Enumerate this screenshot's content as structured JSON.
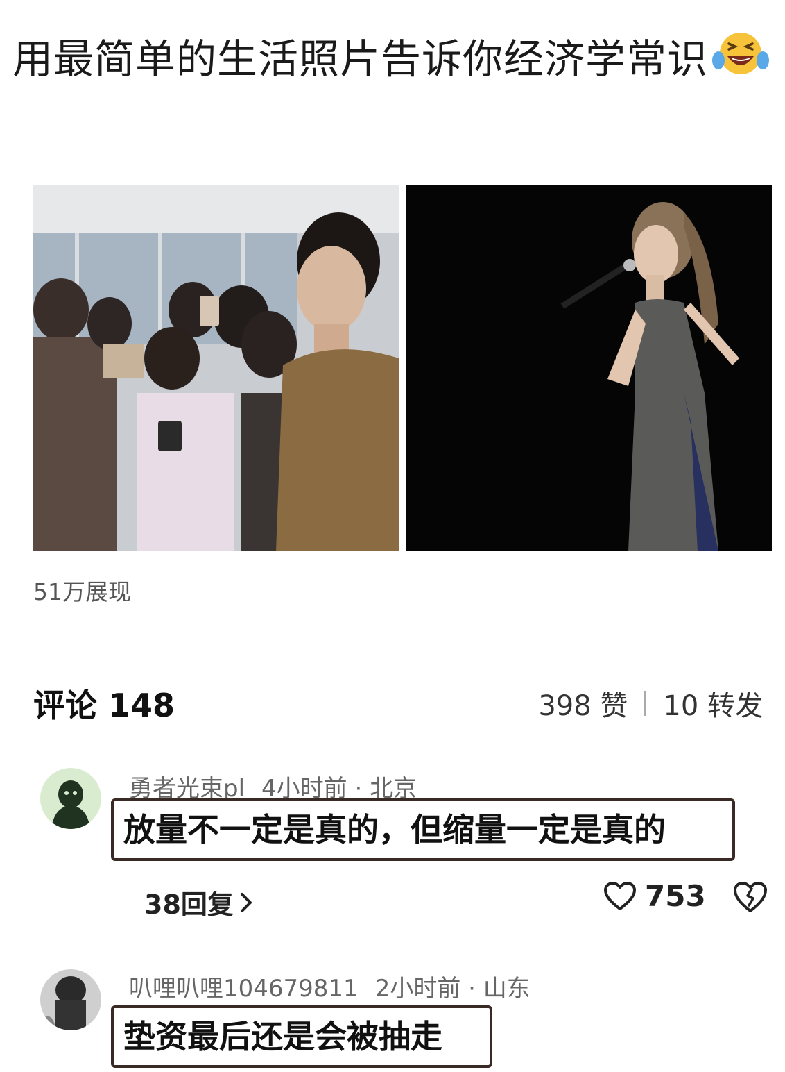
{
  "post": {
    "title": "用最简单的生活照片告诉你经济学常识",
    "views": "51万展现"
  },
  "comments_section": {
    "title": "评论 148",
    "likes": "398 赞",
    "shares": "10 转发"
  },
  "comments": [
    {
      "user": "勇者光束pl",
      "time": "4小时前 · 北京",
      "text": "放量不一定是真的，但缩量一定是真的",
      "replies": "38回复",
      "likes": "753"
    },
    {
      "user": "叭哩叭哩104679811",
      "time": "2小时前 · 山东",
      "text": "垫资最后还是会被抽走"
    }
  ],
  "colors": {
    "comment_border": "#3a2a26",
    "avatar_green": "#d9ecd0",
    "avatar_figure": "#1f3320"
  },
  "icons": [
    "laughing-tears-emoji-icon",
    "chevron-right-icon",
    "heart-icon",
    "broken-heart-icon"
  ]
}
